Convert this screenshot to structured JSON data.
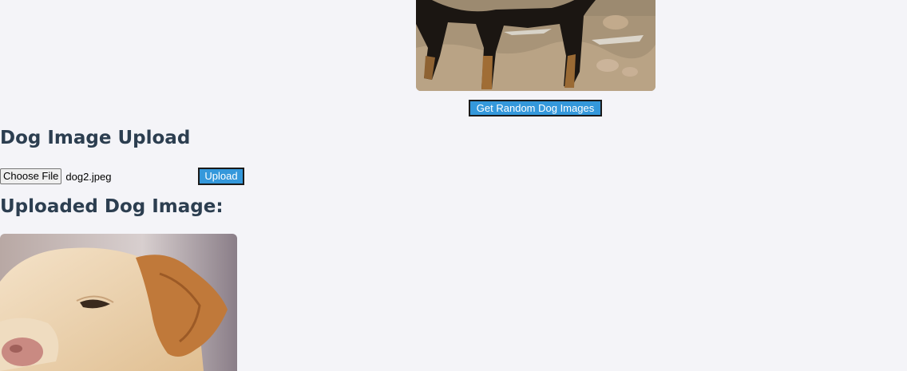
{
  "random": {
    "image_alt": "Random dog image",
    "button_label": "Get Random Dog Images"
  },
  "upload": {
    "heading": "Dog Image Upload",
    "choose_file_label": "Choose File",
    "file_name": "dog2.jpeg",
    "upload_label": "Upload"
  },
  "uploaded": {
    "heading": "Uploaded Dog Image:",
    "image_alt": "Uploaded dog image"
  },
  "colors": {
    "background": "#f4f4f8",
    "accent": "#3498db",
    "heading": "#2c3e50"
  }
}
